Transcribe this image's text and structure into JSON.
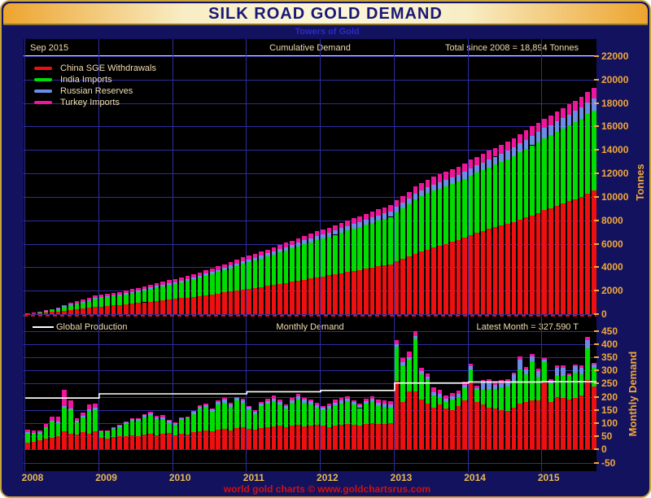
{
  "window": {
    "title": "SILK ROAD GOLD DEMAND",
    "subtitle": "Towers of Gold",
    "footer": "world gold charts © www.goldchartsrus.com"
  },
  "top_chart": {
    "date_label": "Sep  2015",
    "title": "Cumulative Demand",
    "total_label": "Total since 2008 = 18,894 Tonnes",
    "ylabel": "Tonnes",
    "y_ticks": [
      0,
      2000,
      4000,
      6000,
      8000,
      10000,
      12000,
      14000,
      16000,
      18000,
      20000,
      22000
    ],
    "legend": [
      {
        "label": "China SGE Withdrawals",
        "color": "#ee1010"
      },
      {
        "label": "India Imports",
        "color": "#00dd00"
      },
      {
        "label": "Russian Reserves",
        "color": "#6d8ce8"
      },
      {
        "label": "Turkey Imports",
        "color": "#ef169c"
      }
    ]
  },
  "bottom_chart": {
    "legend_label": "Global Production",
    "title": "Monthly Demand",
    "latest_label": "Latest Month = 327.590 T",
    "ylabel": "Monthly Demand",
    "y_ticks": [
      -50,
      0,
      50,
      100,
      150,
      200,
      250,
      300,
      350,
      400,
      450
    ]
  },
  "x_axis": {
    "years": [
      "2008",
      "2009",
      "2010",
      "2011",
      "2012",
      "2013",
      "2014",
      "2015"
    ]
  },
  "colors": {
    "background": "#12125e",
    "plot_background": "#000000",
    "gridline": "#2d2da2",
    "tick_text": "#f1a83c",
    "year_text": "#e5b94a",
    "header_text": "#f0deb0",
    "divider_red": "#e01010",
    "production_line": "#ffffff"
  },
  "chart_data": {
    "type": "bar",
    "stacked": true,
    "x_unit": "month",
    "start": "2008-01",
    "end": "2015-09",
    "months": 93,
    "panels": [
      {
        "title": "Cumulative Demand",
        "mode": "cumulative_stacked_bar",
        "ylabel": "Tonnes",
        "ylim": [
          0,
          22000
        ],
        "total_since_2008": "18,894 Tonnes"
      },
      {
        "title": "Monthly Demand",
        "mode": "monthly_stacked_bar",
        "ylabel": "Monthly Demand",
        "ylim": [
          -50,
          450
        ],
        "latest_month": "327.590 T"
      }
    ],
    "series": [
      {
        "name": "China SGE Withdrawals",
        "color": "#ee1010",
        "monthly": [
          25,
          30,
          35,
          40,
          45,
          50,
          70,
          60,
          58,
          65,
          60,
          70,
          45,
          40,
          48,
          50,
          52,
          55,
          50,
          58,
          60,
          55,
          60,
          62,
          55,
          60,
          58,
          65,
          70,
          72,
          68,
          75,
          78,
          72,
          80,
          84,
          78,
          75,
          80,
          85,
          88,
          90,
          85,
          92,
          95,
          88,
          92,
          95,
          90,
          85,
          92,
          95,
          98,
          95,
          92,
          98,
          100,
          96,
          98,
          100,
          260,
          180,
          220,
          220,
          190,
          175,
          160,
          170,
          155,
          150,
          165,
          187,
          255,
          180,
          170,
          160,
          155,
          150,
          145,
          160,
          175,
          180,
          185,
          187,
          255,
          180,
          200,
          195,
          190,
          195,
          205,
          264,
          240
        ]
      },
      {
        "name": "India Imports",
        "color": "#00dd00",
        "monthly": [
          35,
          30,
          25,
          40,
          60,
          50,
          90,
          90,
          45,
          55,
          85,
          80,
          20,
          25,
          30,
          35,
          45,
          55,
          60,
          65,
          70,
          60,
          55,
          39,
          40,
          55,
          60,
          70,
          85,
          90,
          75,
          95,
          100,
          90,
          105,
          93,
          75,
          60,
          85,
          90,
          95,
          80,
          70,
          85,
          95,
          90,
          80,
          64,
          60,
          70,
          75,
          80,
          85,
          75,
          65,
          75,
          80,
          70,
          65,
          60,
          130,
          140,
          120,
          200,
          95,
          90,
          45,
          30,
          25,
          40,
          35,
          45,
          50,
          45,
          60,
          70,
          75,
          85,
          95,
          100,
          130,
          105,
          150,
          90,
          75,
          70,
          80,
          85,
          90,
          95,
          80,
          120,
          70
        ]
      },
      {
        "name": "Russian Reserves",
        "color": "#6d8ce8",
        "monthly": [
          5,
          4,
          6,
          5,
          5,
          6,
          5,
          6,
          6,
          7,
          6,
          8,
          4,
          5,
          5,
          6,
          6,
          5,
          6,
          7,
          8,
          6,
          7,
          8,
          6,
          5,
          6,
          7,
          8,
          7,
          8,
          9,
          10,
          9,
          10,
          10,
          8,
          7,
          8,
          9,
          9,
          10,
          9,
          10,
          11,
          10,
          11,
          10,
          8,
          9,
          9,
          10,
          10,
          9,
          10,
          11,
          11,
          10,
          11,
          12,
          9,
          10,
          10,
          11,
          11,
          10,
          11,
          12,
          12,
          11,
          12,
          12,
          10,
          9,
          26,
          28,
          16,
          17,
          18,
          24,
          37,
          19,
          19,
          21,
          10,
          9,
          30,
          30,
          3,
          25,
          24,
          31,
          11
        ]
      },
      {
        "name": "Turkey Imports",
        "color": "#ef169c",
        "monthly": [
          10,
          8,
          5,
          12,
          15,
          20,
          60,
          30,
          8,
          12,
          20,
          15,
          2,
          1,
          1,
          2,
          3,
          2,
          3,
          4,
          5,
          6,
          8,
          3,
          2,
          3,
          2,
          3,
          4,
          5,
          4,
          6,
          8,
          6,
          5,
          4,
          5,
          6,
          8,
          10,
          12,
          10,
          8,
          9,
          10,
          8,
          6,
          8,
          8,
          10,
          12,
          10,
          8,
          6,
          8,
          10,
          12,
          14,
          12,
          10,
          15,
          18,
          20,
          16,
          14,
          12,
          20,
          15,
          12,
          14,
          12,
          12,
          10,
          8,
          6,
          8,
          10,
          12,
          10,
          8,
          12,
          10,
          8,
          8,
          8,
          6,
          10,
          8,
          6,
          8,
          10,
          12,
          7
        ]
      }
    ],
    "line_series": {
      "name": "Global Production",
      "color": "#ffffff",
      "years": [
        2008,
        2009,
        2010,
        2011,
        2012,
        2013,
        2014,
        2015
      ],
      "monthly_rate_by_year": [
        195,
        211,
        211,
        219,
        224,
        252,
        256,
        257
      ]
    }
  }
}
